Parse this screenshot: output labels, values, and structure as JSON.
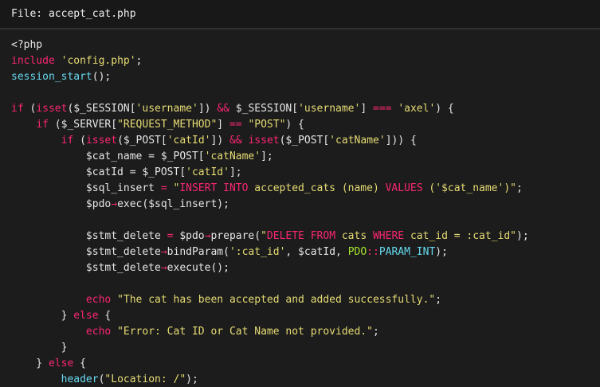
{
  "header": {
    "label": "File:",
    "filename": "accept_cat.php"
  },
  "colors": {
    "background": "#1c1c1c",
    "keyword": "#f92672",
    "function": "#66d9ef",
    "string": "#e6db74",
    "constant": "#a6e22e",
    "text": "#e6e6e6"
  },
  "code_lines": [
    [
      {
        "t": "<?php",
        "c": "default"
      }
    ],
    [
      {
        "t": "include",
        "c": "kw"
      },
      {
        "t": " ",
        "c": "default"
      },
      {
        "t": "'config.php'",
        "c": "str"
      },
      {
        "t": ";",
        "c": "punct"
      }
    ],
    [
      {
        "t": "session_start",
        "c": "fn"
      },
      {
        "t": "();",
        "c": "punct"
      }
    ],
    [],
    [
      {
        "t": "if",
        "c": "kw"
      },
      {
        "t": " (",
        "c": "punct"
      },
      {
        "t": "isset",
        "c": "kw"
      },
      {
        "t": "($_SESSION[",
        "c": "var"
      },
      {
        "t": "'username'",
        "c": "str"
      },
      {
        "t": "]) ",
        "c": "var"
      },
      {
        "t": "&&",
        "c": "op"
      },
      {
        "t": " $_SESSION[",
        "c": "var"
      },
      {
        "t": "'username'",
        "c": "str"
      },
      {
        "t": "] ",
        "c": "var"
      },
      {
        "t": "===",
        "c": "op"
      },
      {
        "t": " ",
        "c": "default"
      },
      {
        "t": "'axel'",
        "c": "str"
      },
      {
        "t": ") {",
        "c": "punct"
      }
    ],
    [
      {
        "t": "    ",
        "c": "default"
      },
      {
        "t": "if",
        "c": "kw"
      },
      {
        "t": " ($_SERVER[",
        "c": "var"
      },
      {
        "t": "\"REQUEST_METHOD\"",
        "c": "str"
      },
      {
        "t": "] ",
        "c": "var"
      },
      {
        "t": "==",
        "c": "op"
      },
      {
        "t": " ",
        "c": "default"
      },
      {
        "t": "\"POST\"",
        "c": "str"
      },
      {
        "t": ") {",
        "c": "punct"
      }
    ],
    [
      {
        "t": "        ",
        "c": "default"
      },
      {
        "t": "if",
        "c": "kw"
      },
      {
        "t": " (",
        "c": "punct"
      },
      {
        "t": "isset",
        "c": "kw"
      },
      {
        "t": "($_POST[",
        "c": "var"
      },
      {
        "t": "'catId'",
        "c": "str"
      },
      {
        "t": "]) ",
        "c": "var"
      },
      {
        "t": "&&",
        "c": "op"
      },
      {
        "t": " ",
        "c": "default"
      },
      {
        "t": "isset",
        "c": "kw"
      },
      {
        "t": "($_POST[",
        "c": "var"
      },
      {
        "t": "'catName'",
        "c": "str"
      },
      {
        "t": "])) {",
        "c": "punct"
      }
    ],
    [
      {
        "t": "            $cat_name = $_POST[",
        "c": "var"
      },
      {
        "t": "'catName'",
        "c": "str"
      },
      {
        "t": "];",
        "c": "punct"
      }
    ],
    [
      {
        "t": "            $catId = $_POST[",
        "c": "var"
      },
      {
        "t": "'catId'",
        "c": "str"
      },
      {
        "t": "];",
        "c": "punct"
      }
    ],
    [
      {
        "t": "            $sql_insert ",
        "c": "var"
      },
      {
        "t": "=",
        "c": "op"
      },
      {
        "t": " ",
        "c": "default"
      },
      {
        "t": "\"",
        "c": "str"
      },
      {
        "t": "INSERT INTO",
        "c": "str-fn"
      },
      {
        "t": " accepted_cats (name) ",
        "c": "str"
      },
      {
        "t": "VALUES",
        "c": "str-fn"
      },
      {
        "t": " ('$cat_name')\"",
        "c": "str"
      },
      {
        "t": ";",
        "c": "punct"
      }
    ],
    [
      {
        "t": "            $pdo",
        "c": "var"
      },
      {
        "t": "→",
        "c": "op"
      },
      {
        "t": "exec($sql_insert);",
        "c": "var"
      }
    ],
    [],
    [
      {
        "t": "            $stmt_delete ",
        "c": "var"
      },
      {
        "t": "=",
        "c": "op"
      },
      {
        "t": " $pdo",
        "c": "var"
      },
      {
        "t": "→",
        "c": "op"
      },
      {
        "t": "prepare(",
        "c": "var"
      },
      {
        "t": "\"",
        "c": "str"
      },
      {
        "t": "DELETE FROM",
        "c": "str-fn"
      },
      {
        "t": " cats ",
        "c": "str"
      },
      {
        "t": "WHERE",
        "c": "str-fn"
      },
      {
        "t": " cat_id = :cat_id\"",
        "c": "str"
      },
      {
        "t": ");",
        "c": "punct"
      }
    ],
    [
      {
        "t": "            $stmt_delete",
        "c": "var"
      },
      {
        "t": "→",
        "c": "op"
      },
      {
        "t": "bindParam(",
        "c": "var"
      },
      {
        "t": "':cat_id'",
        "c": "str"
      },
      {
        "t": ", $catId, ",
        "c": "var"
      },
      {
        "t": "PDO",
        "c": "const"
      },
      {
        "t": "::",
        "c": "op"
      },
      {
        "t": "PARAM_INT",
        "c": "fn"
      },
      {
        "t": ");",
        "c": "punct"
      }
    ],
    [
      {
        "t": "            $stmt_delete",
        "c": "var"
      },
      {
        "t": "→",
        "c": "op"
      },
      {
        "t": "execute();",
        "c": "var"
      }
    ],
    [],
    [
      {
        "t": "            ",
        "c": "default"
      },
      {
        "t": "echo",
        "c": "kw"
      },
      {
        "t": " ",
        "c": "default"
      },
      {
        "t": "\"The cat has been accepted and added successfully.\"",
        "c": "str"
      },
      {
        "t": ";",
        "c": "punct"
      }
    ],
    [
      {
        "t": "        } ",
        "c": "punct"
      },
      {
        "t": "else",
        "c": "kw"
      },
      {
        "t": " {",
        "c": "punct"
      }
    ],
    [
      {
        "t": "            ",
        "c": "default"
      },
      {
        "t": "echo",
        "c": "kw"
      },
      {
        "t": " ",
        "c": "default"
      },
      {
        "t": "\"Error: Cat ID or Cat Name not provided.\"",
        "c": "str"
      },
      {
        "t": ";",
        "c": "punct"
      }
    ],
    [
      {
        "t": "        }",
        "c": "punct"
      }
    ],
    [
      {
        "t": "    } ",
        "c": "punct"
      },
      {
        "t": "else",
        "c": "kw"
      },
      {
        "t": " {",
        "c": "punct"
      }
    ],
    [
      {
        "t": "        ",
        "c": "default"
      },
      {
        "t": "header",
        "c": "fn"
      },
      {
        "t": "(",
        "c": "punct"
      },
      {
        "t": "\"Location: /\"",
        "c": "str"
      },
      {
        "t": ");",
        "c": "punct"
      }
    ]
  ]
}
